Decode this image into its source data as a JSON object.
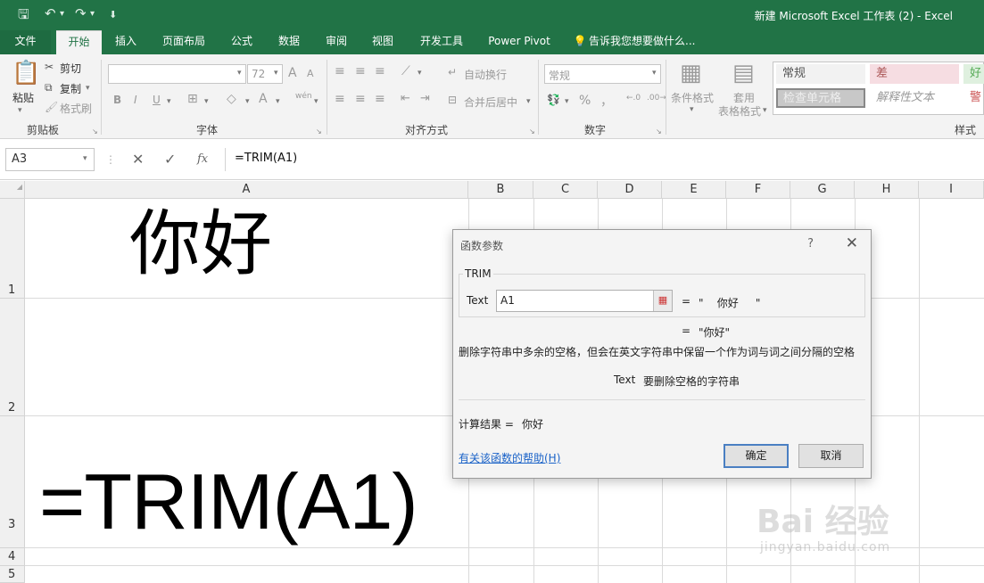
{
  "window": {
    "title": "新建 Microsoft Excel 工作表 (2) - Excel",
    "quick_access": {
      "save_icon": "save-icon",
      "undo_icon": "undo-icon",
      "redo_icon": "redo-icon",
      "customize_icon": "chevron-down-icon"
    }
  },
  "tabs": [
    {
      "label": "文件"
    },
    {
      "label": "开始"
    },
    {
      "label": "插入"
    },
    {
      "label": "页面布局"
    },
    {
      "label": "公式"
    },
    {
      "label": "数据"
    },
    {
      "label": "审阅"
    },
    {
      "label": "视图"
    },
    {
      "label": "开发工具"
    },
    {
      "label": "Power Pivot"
    },
    {
      "label": "告诉我您想要做什么..."
    }
  ],
  "ribbon": {
    "clipboard": {
      "paste": "粘贴",
      "cut": "剪切",
      "copy": "复制",
      "format_painter": "格式刷",
      "group": "剪贴板"
    },
    "font": {
      "size": "72",
      "bold": "B",
      "italic": "I",
      "underline": "U",
      "font_color": "A",
      "wen": "wén",
      "grow": "A",
      "shrink": "A",
      "group": "字体"
    },
    "alignment": {
      "wrap": "自动换行",
      "merge": "合并后居中",
      "group": "对齐方式"
    },
    "number": {
      "format": "常规",
      "percent": "%",
      "comma": "，",
      "group": "数字"
    },
    "styles": {
      "conditional": "条件格式",
      "table_format_1": "套用",
      "table_format_2": "表格格式",
      "normal": "常规",
      "bad": "差",
      "good": "好",
      "check_cell": "检查单元格",
      "explanatory": "解释性文本",
      "warning": "警",
      "group": "样式"
    }
  },
  "formula_bar": {
    "name_box": "A3",
    "formula": "=TRIM(A1)",
    "cancel": "✕",
    "enter": "✓",
    "fx": "fx"
  },
  "grid": {
    "columns": [
      "A",
      "B",
      "C",
      "D",
      "E",
      "F",
      "G",
      "H",
      "I"
    ],
    "rows": [
      "1",
      "2",
      "3",
      "4",
      "5"
    ],
    "cells": {
      "A1": "你好",
      "A3": "=TRIM(A1)"
    }
  },
  "dialog": {
    "title": "函数参数",
    "help_button": "?",
    "close_button": "✕",
    "function_name": "TRIM",
    "arg_label": "Text",
    "arg_value": "A1",
    "arg_eq": "=",
    "arg_result": "\"    你好     \"",
    "result_eq": "=",
    "result_value": "\"你好\"",
    "description": "删除字符串中多余的空格，但会在英文字符串中保留一个作为词与词之间分隔的空格",
    "arg_help_name": "Text",
    "arg_help_text": "要删除空格的字符串",
    "calc_label": "计算结果 =",
    "calc_value": "你好",
    "help_link": "有关该函数的帮助(H)",
    "ok": "确定",
    "cancel": "取消"
  },
  "watermark": {
    "logo": "Bai 经验",
    "sub": "jingyan.baidu.com"
  }
}
